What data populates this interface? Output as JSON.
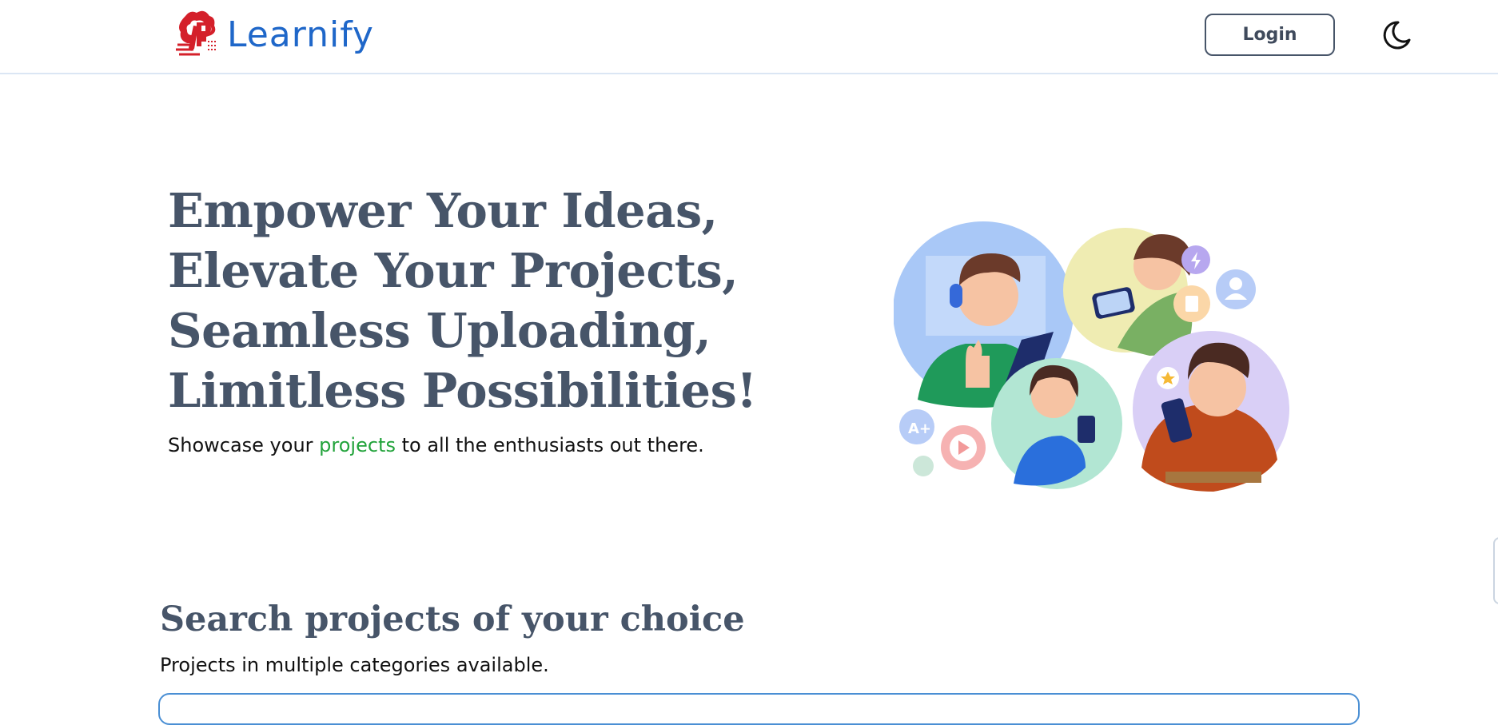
{
  "header": {
    "brand": "Learnify",
    "login_label": "Login",
    "theme_icon": "moon-icon"
  },
  "hero": {
    "title_lines": [
      "Empower Your Ideas,",
      "Elevate Your Projects,",
      "Seamless Uploading,",
      "Limitless Possibilities!"
    ],
    "subtitle_pre": "Showcase your ",
    "subtitle_highlight": "projects",
    "subtitle_post": " to all the enthusiasts out there.",
    "illustration": "people-using-devices-illustration"
  },
  "search": {
    "title": "Search projects of your choice",
    "subtitle": "Projects in multiple categories available."
  },
  "colors": {
    "brand_blue": "#1f67c9",
    "brand_red": "#d4202a",
    "heading": "#475569",
    "highlight_green": "#22a33b",
    "border_blue": "#4a8fd4"
  }
}
